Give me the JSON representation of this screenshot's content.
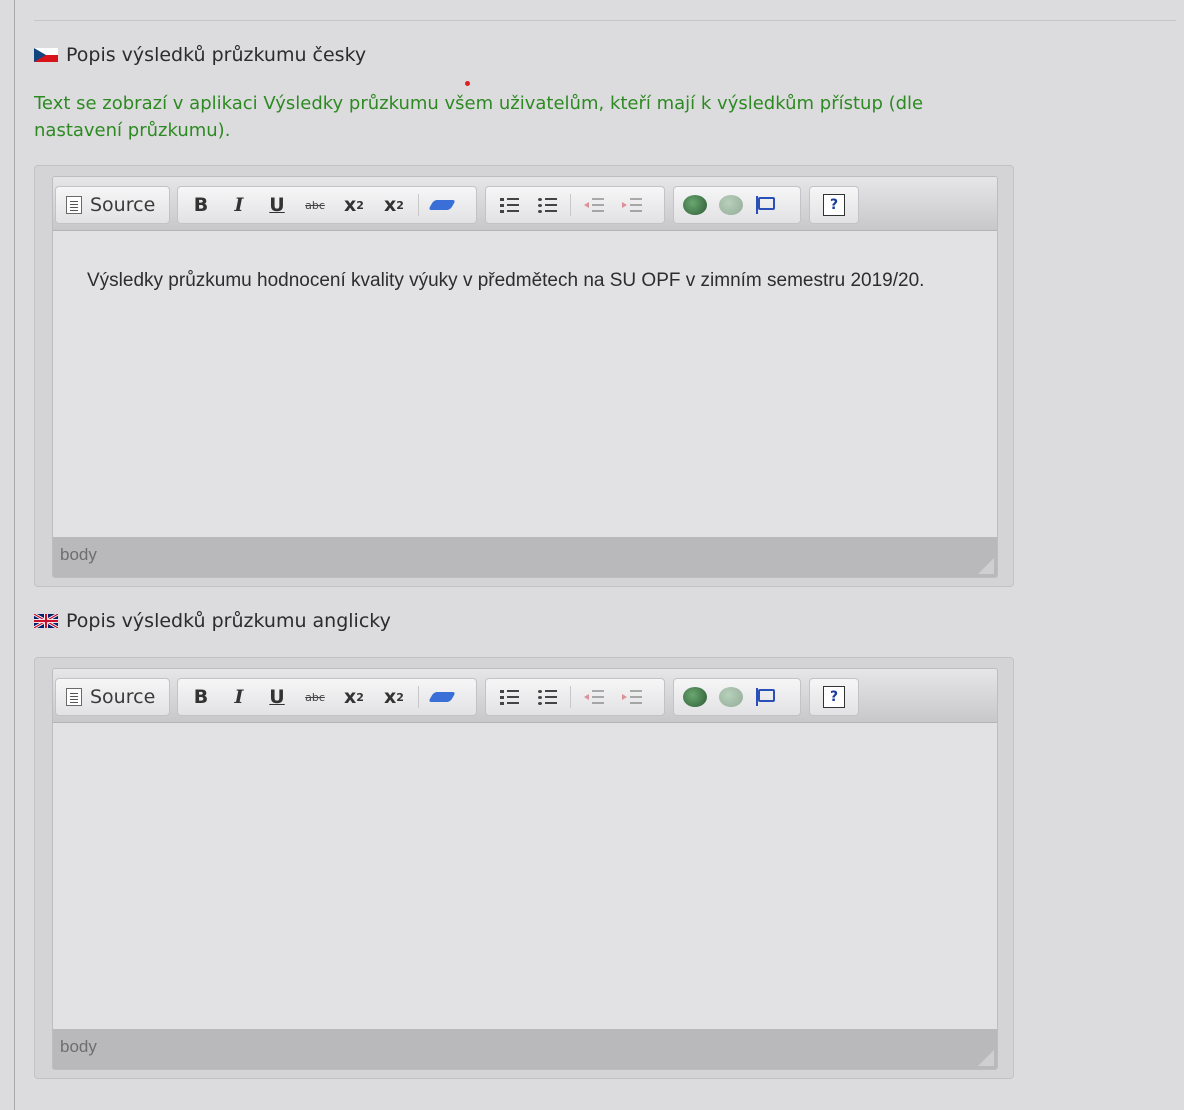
{
  "czech_section": {
    "label": "Popis výsledků průzkumu česky",
    "flag_icon": "czech-flag-icon",
    "hint": "Text se zobrazí v aplikaci Výsledky průzkumu všem uživatelům, kteří mají k výsledkům přístup (dle nastavení průzkumu).",
    "content": "Výsledky průzkumu hodnocení kvality výuky v předmětech na SU OPF v zimním semestru 2019/20.",
    "status": "body"
  },
  "english_section": {
    "label": "Popis výsledků průzkumu anglicky",
    "flag_icon": "uk-flag-icon",
    "content": "",
    "status": "body"
  },
  "toolbar": {
    "source_label": "Source",
    "bold": "B",
    "italic": "I",
    "underline": "U",
    "strike": "abc",
    "subscript": "x",
    "subscript_mark": "2",
    "superscript": "x",
    "superscript_mark": "2",
    "help": "?"
  },
  "colors": {
    "hint_text": "#2d8a22",
    "background": "#dcdcde"
  }
}
